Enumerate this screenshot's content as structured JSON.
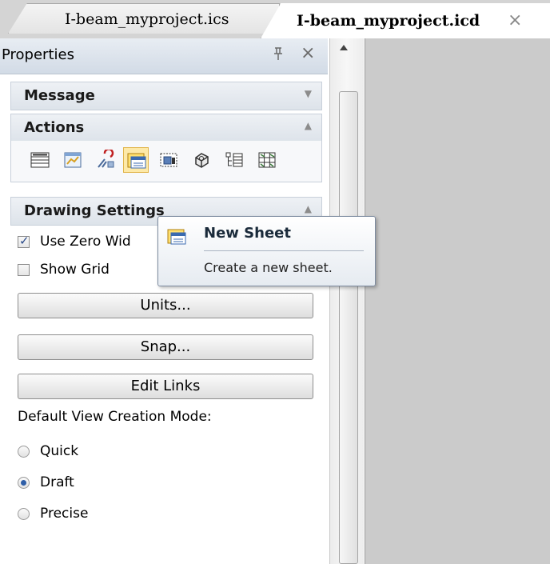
{
  "tabs": [
    {
      "label": "I-beam_myproject.ics",
      "active": false
    },
    {
      "label": "I-beam_myproject.icd",
      "active": true,
      "close": "×"
    }
  ],
  "panel": {
    "title": "Properties",
    "pin_glyph": "ᵻ",
    "close_glyph": "×"
  },
  "sections": {
    "message": {
      "title": "Message",
      "chevron": "▼"
    },
    "actions": {
      "title": "Actions",
      "chevron": "▲"
    },
    "drawing_settings": {
      "title": "Drawing Settings",
      "chevron": "▲"
    }
  },
  "actions_toolbar": {
    "icons": [
      "table-icon",
      "sheet-chart-icon",
      "link-tool-icon",
      "new-sheet-icon",
      "frame-icon",
      "3d-part-icon",
      "tree-list-icon",
      "grid-settings-icon"
    ],
    "selected_index": 3
  },
  "drawing_settings": {
    "use_zero_width": {
      "label": "Use Zero Wid",
      "checked": true
    },
    "show_grid": {
      "label": "Show Grid",
      "checked": false
    },
    "units_button": "Units...",
    "snap_button": "Snap...",
    "edit_links_button": "Edit Links",
    "view_mode_label": "Default View Creation Mode:",
    "view_modes": [
      {
        "label": "Quick",
        "selected": false
      },
      {
        "label": "Draft",
        "selected": true
      },
      {
        "label": "Precise",
        "selected": false
      }
    ]
  },
  "tooltip": {
    "title": "New Sheet",
    "description": "Create a new sheet."
  },
  "colors": {
    "selection_highlight": "#fde9a8",
    "canvas_bg": "#cbcbcb",
    "radio_dot": "#2f5fa8"
  }
}
